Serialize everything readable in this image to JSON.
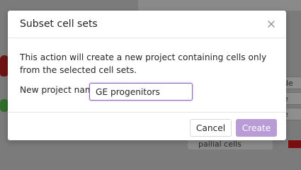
{
  "background": {
    "fragment_labels": [
      "de",
      "e",
      "e"
    ],
    "pill_text": "pailial cells"
  },
  "modal": {
    "title": "Subset cell sets",
    "description": "This action will create a new project containing cells only from the selected cell sets.",
    "field": {
      "label": "New project name",
      "value": "GE progenitors"
    },
    "buttons": {
      "cancel": "Cancel",
      "create": "Create"
    }
  },
  "colors": {
    "primary": "#8b5fb8",
    "primary_disabled": "#b99bd6",
    "overlay": "#7b7b7b"
  },
  "icons": {
    "close": "close-icon"
  }
}
